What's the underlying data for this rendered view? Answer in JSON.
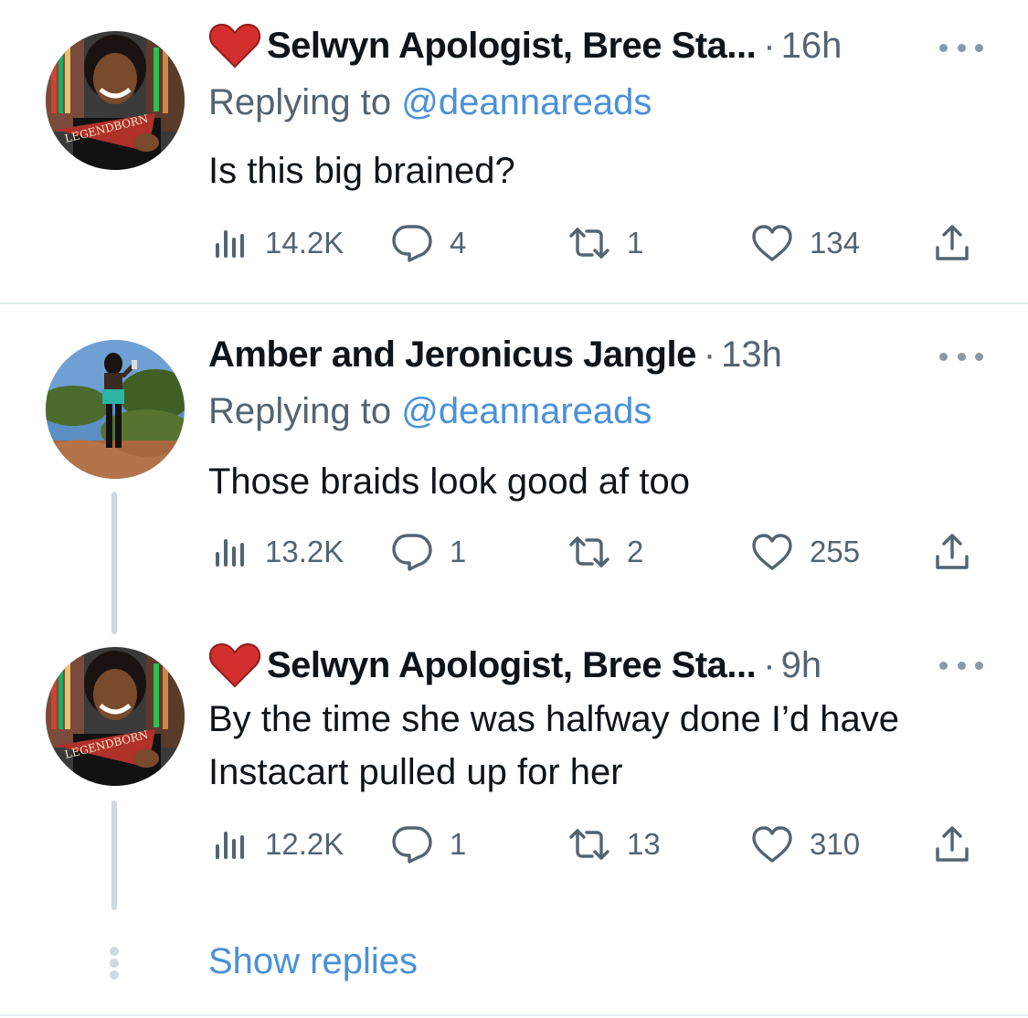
{
  "tweets": [
    {
      "author": "Selwyn Apologist, Bree Sta...",
      "has_heart_emoji": true,
      "separator": "·",
      "time": "16h",
      "replying_prefix": "Replying to ",
      "replying_handle": "@deannareads",
      "text": "Is this big brained?",
      "views": "14.2K",
      "replies": "4",
      "retweets": "1",
      "likes": "134"
    },
    {
      "author": "Amber and Jeronicus Jangle",
      "has_heart_emoji": false,
      "separator": "·",
      "time": "13h",
      "replying_prefix": "Replying to ",
      "replying_handle": "@deannareads",
      "text": "Those braids look good af too",
      "views": "13.2K",
      "replies": "1",
      "retweets": "2",
      "likes": "255"
    },
    {
      "author": "Selwyn Apologist, Bree Sta...",
      "has_heart_emoji": true,
      "separator": "·",
      "time": "9h",
      "text_line1": "By the time she was halfway done I’d have",
      "text_line2": "Instacart pulled up for her",
      "views": "12.2K",
      "replies": "1",
      "retweets": "13",
      "likes": "310"
    }
  ],
  "show_replies": "Show replies",
  "avatar_pennant_text": "LEGENDBORN",
  "icons": {
    "views": "views-icon",
    "reply": "reply-icon",
    "retweet": "retweet-icon",
    "like": "heart-icon",
    "share": "share-icon",
    "more": "more-icon"
  },
  "colors": {
    "text": "#0f1419",
    "secondary": "#536471",
    "link": "#4a90d9",
    "thread_line": "#cfd9de",
    "heart_emoji": "#d32f2f"
  }
}
